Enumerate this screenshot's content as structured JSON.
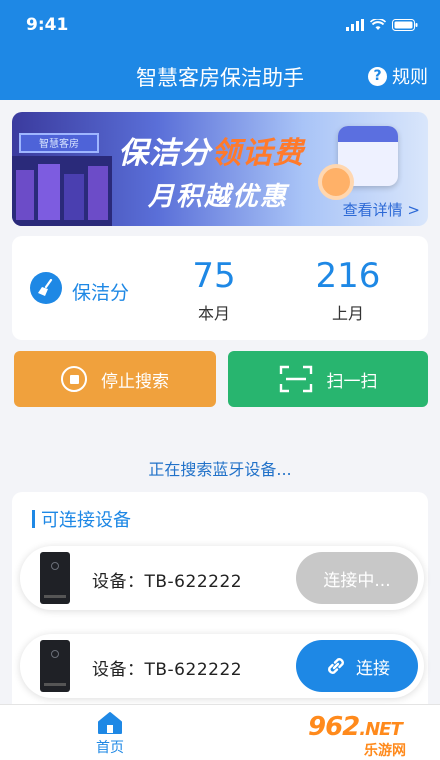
{
  "status_bar": {
    "time": "9:41"
  },
  "header": {
    "title": "智慧客房保洁助手",
    "rules_label": "规则",
    "rules_icon": "question-circle-icon"
  },
  "banner": {
    "headline_part1": "保洁分",
    "headline_part2": "领话费",
    "subline": "月积越优惠",
    "link": "查看详情 >",
    "storefront_sign": "智慧客房"
  },
  "score": {
    "label": "保洁分",
    "this_month_value": "75",
    "this_month_label": "本月",
    "last_month_value": "216",
    "last_month_label": "上月"
  },
  "actions": {
    "stop_label": "停止搜索",
    "scan_label": "扫一扫"
  },
  "search_status": "正在搜索蓝牙设备...",
  "devices_panel": {
    "title": "可连接设备",
    "devices": [
      {
        "name": "设备：TB-622222",
        "button": "连接中..."
      },
      {
        "name": "设备：TB-622222",
        "button": "连接"
      }
    ]
  },
  "tabbar": {
    "home_label": "首页"
  },
  "watermark": {
    "brand": "962",
    "tld": ".NET",
    "sub": "乐游网"
  },
  "colors": {
    "primary": "#1e88e5",
    "orange": "#f0a13d",
    "green": "#28b56f",
    "gray": "#c8c8c8"
  }
}
